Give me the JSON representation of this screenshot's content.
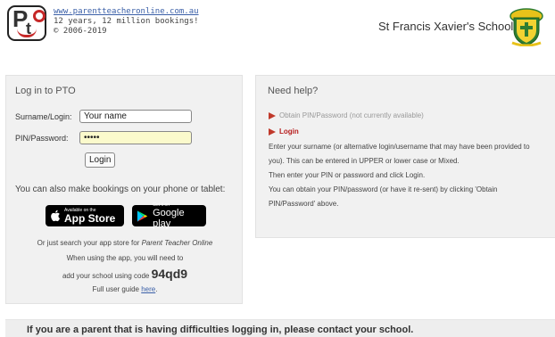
{
  "header": {
    "logo_alt": "PTO logo",
    "site_url": "www.parentteacheronline.com.au",
    "tagline": "12 years, 12 million bookings!",
    "copyright": "© 2006-2019",
    "school_name": "St Francis Xavier's School"
  },
  "login": {
    "title": "Log in to PTO",
    "surname_label": "Surname/Login:",
    "surname_value": "Your name",
    "pin_label": "PIN/Password:",
    "pin_value": "•••••",
    "login_button": "Login",
    "also_text": "You can also make bookings on your phone or tablet:",
    "app_store_small": "Available on the",
    "app_store_big": "App Store",
    "google_play_small": "Get it on",
    "google_play_big": "Google play",
    "search_text_prefix": "Or just search your app store for ",
    "search_text_italic": "Parent Teacher Online",
    "when_using": "When using the app, you will need to",
    "add_school_prefix": "add your school using code ",
    "school_code": "94qd9",
    "guide_prefix": "Full user guide ",
    "guide_link": "here",
    "guide_suffix": "."
  },
  "help": {
    "title": "Need help?",
    "obtain_pin_link": "Obtain PIN/Password (not currently available)",
    "login_link": "Login",
    "paragraph1": "Enter your surname (or alternative login/username that may have been provided to you). This can be entered in UPPER or lower case or Mixed.",
    "paragraph2": "Then enter your PIN or password and click Login.",
    "paragraph3": "You can obtain your PIN/password (or have it re-sent) by clicking 'Obtain PIN/Password' above."
  },
  "footer": {
    "notice": "If you are a parent that is having difficulties logging in, please contact your school."
  },
  "colors": {
    "accent_red": "#c0392b",
    "link_blue": "#3a5fa7",
    "panel_bg": "#f1f1f1",
    "input_fill": "#fbfacc"
  }
}
